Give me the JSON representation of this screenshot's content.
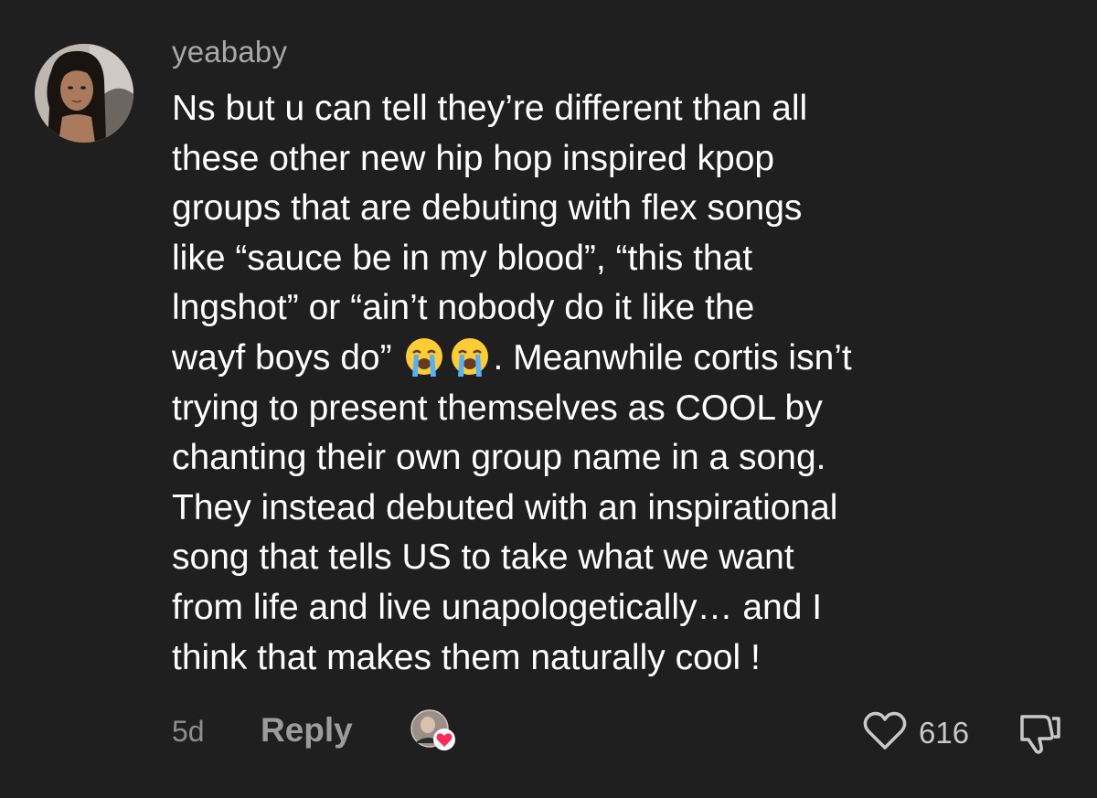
{
  "comment": {
    "username": "yeababy",
    "text_lines": [
      "Ns but u can tell they’re different than all",
      "these other new hip hop inspired kpop",
      "groups that are debuting with flex songs",
      "like “sauce be in my blood”, “this that",
      "lngshot” or “ain’t nobody do it like the",
      "wayf boys do”",
      ". Meanwhile cortis isn’t",
      "trying to present themselves as COOL by",
      "chanting their own group name in a song.",
      "They instead debuted with an inspirational",
      "song that tells US to take what we want",
      "from life and live unapologetically… and I",
      "think that makes them naturally cool !"
    ],
    "emojis": [
      "loudly-crying-face",
      "loudly-crying-face"
    ],
    "time_ago": "5d",
    "reply_label": "Reply",
    "like_count": "616",
    "icons": {
      "like": "heart-outline-icon",
      "dislike": "thumbs-down-icon",
      "creator_liked": "creator-liked-heart-badge"
    }
  },
  "colors": {
    "background": "#1f1f1f",
    "text": "#ffffff",
    "muted": "#a8a8a8",
    "creator_heart": "#fe2c55"
  }
}
